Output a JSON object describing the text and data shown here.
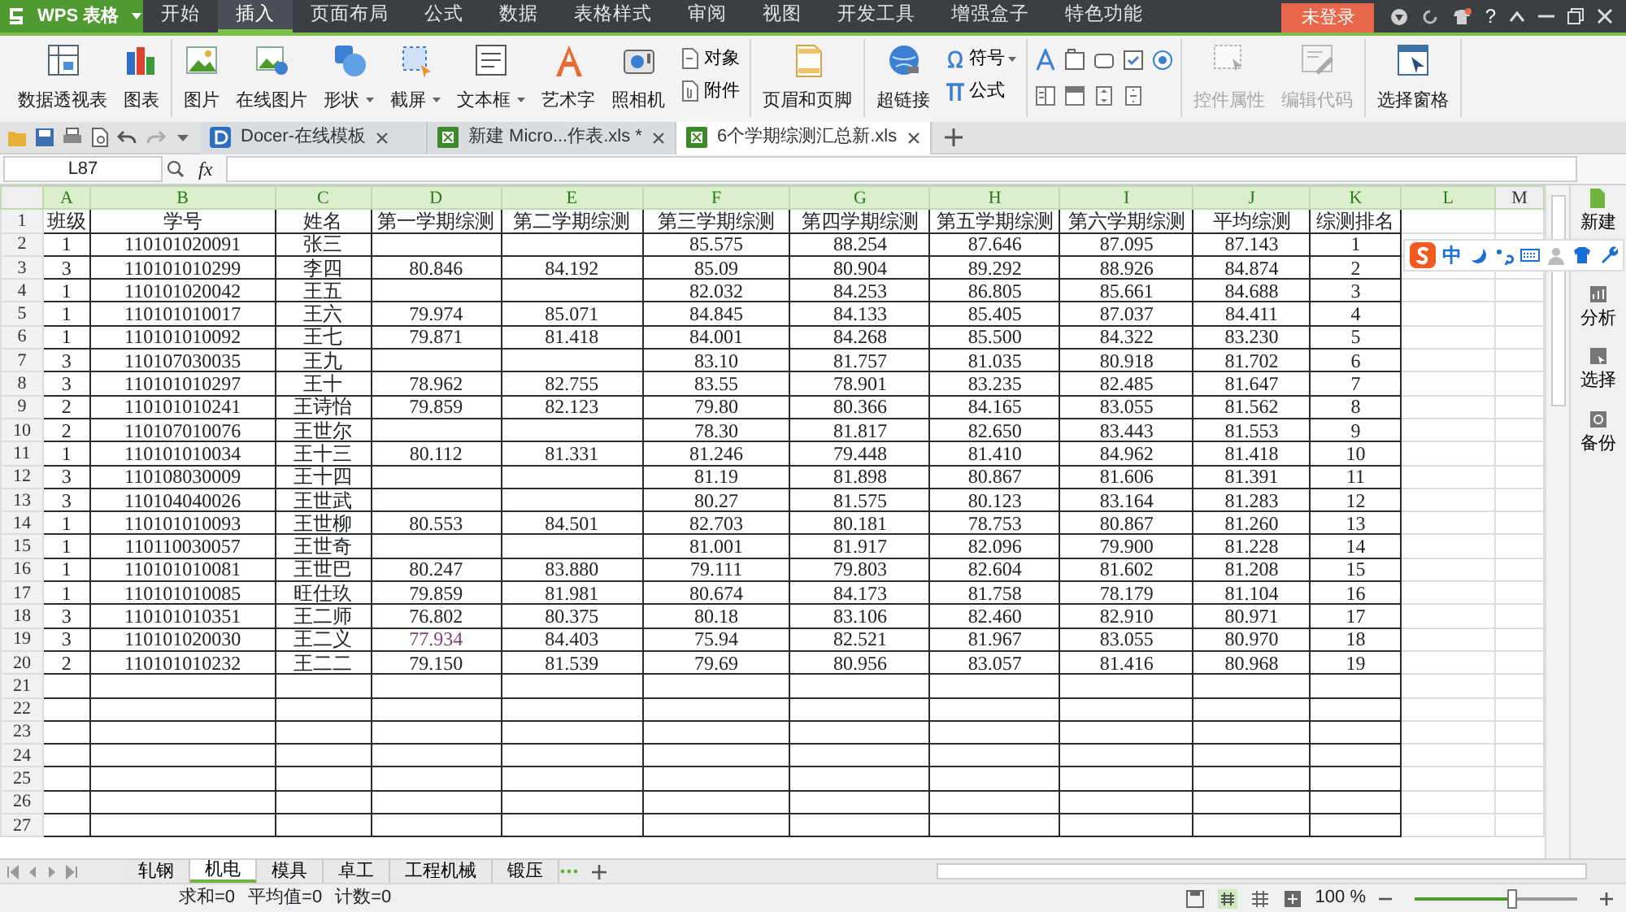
{
  "app": {
    "logo": "WPS 表格",
    "menu_tabs": [
      {
        "label": "开始",
        "selected": false
      },
      {
        "label": "插入",
        "selected": true
      },
      {
        "label": "页面布局",
        "selected": false
      },
      {
        "label": "公式",
        "selected": false
      },
      {
        "label": "数据",
        "selected": false
      },
      {
        "label": "表格样式",
        "selected": false
      },
      {
        "label": "审阅",
        "selected": false
      },
      {
        "label": "视图",
        "selected": false
      },
      {
        "label": "开发工具",
        "selected": false
      },
      {
        "label": "增强盒子",
        "selected": false
      },
      {
        "label": "特色功能",
        "selected": false
      }
    ],
    "login_button": "未登录",
    "help": "?"
  },
  "ribbon": {
    "groups": [
      [
        {
          "kind": "large",
          "label": "数据透视表"
        },
        {
          "kind": "large",
          "label": "图表"
        }
      ],
      [
        {
          "kind": "large",
          "label": "图片"
        },
        {
          "kind": "large",
          "label": "在线图片"
        },
        {
          "kind": "large",
          "label": "形状",
          "dropdown": true
        },
        {
          "kind": "large",
          "label": "截屏",
          "dropdown": true
        },
        {
          "kind": "large",
          "label": "文本框",
          "dropdown": true
        },
        {
          "kind": "large",
          "label": "艺术字"
        },
        {
          "kind": "large",
          "label": "照相机"
        },
        {
          "kind": "stack",
          "items": [
            {
              "label": "对象"
            },
            {
              "label": "附件"
            }
          ]
        }
      ],
      [
        {
          "kind": "large",
          "label": "页眉和页脚"
        }
      ],
      [
        {
          "kind": "large",
          "label": "超链接"
        },
        {
          "kind": "stack",
          "items": [
            {
              "label": "符号",
              "dropdown": true
            },
            {
              "label": "公式"
            }
          ]
        }
      ],
      [
        {
          "kind": "icons"
        }
      ],
      [
        {
          "kind": "large",
          "label": "控件属性",
          "disabled": true
        },
        {
          "kind": "large",
          "label": "编辑代码",
          "disabled": true
        }
      ],
      [
        {
          "kind": "large",
          "label": "选择窗格"
        }
      ]
    ]
  },
  "doc_tabs": [
    {
      "label": "Docer-在线模板",
      "selected": false
    },
    {
      "label": "新建 Micro...作表.xls *",
      "selected": false
    },
    {
      "label": "6个学期综测汇总新.xls",
      "selected": true
    }
  ],
  "formula_bar": {
    "name_box": "L87",
    "function_label": "fx"
  },
  "sheet": {
    "columns": [
      "A",
      "B",
      "C",
      "D",
      "E",
      "F",
      "G",
      "H",
      "I",
      "J",
      "K",
      "L",
      "M"
    ],
    "rows": [
      {
        "number": "1",
        "cells": [
          "班级",
          "学号",
          "姓名",
          "第一学期综测",
          "第二学期综测",
          "第三学期综测",
          "第四学期综测",
          "第五学期综测",
          "第六学期综测",
          "平均综测",
          "综测排名"
        ]
      },
      {
        "number": "2",
        "cells": [
          "1",
          "110101020091",
          "张三",
          null,
          null,
          "85.575",
          "88.254",
          "87.646",
          "87.095",
          "87.143",
          "1"
        ]
      },
      {
        "number": "3",
        "cells": [
          "3",
          "110101010299",
          "李四",
          "80.846",
          "84.192",
          "85.09",
          "80.904",
          "89.292",
          "88.926",
          "84.874",
          "2"
        ]
      },
      {
        "number": "4",
        "cells": [
          "1",
          "110101020042",
          "王五",
          null,
          null,
          "82.032",
          "84.253",
          "86.805",
          "85.661",
          "84.688",
          "3"
        ]
      },
      {
        "number": "5",
        "cells": [
          "1",
          "110101010017",
          "王六",
          "79.974",
          "85.071",
          "84.845",
          "84.133",
          "85.405",
          "87.037",
          "84.411",
          "4"
        ]
      },
      {
        "number": "6",
        "cells": [
          "1",
          "110101010092",
          "王七",
          "79.871",
          "81.418",
          "84.001",
          "84.268",
          "85.500",
          "84.322",
          "83.230",
          "5"
        ]
      },
      {
        "number": "7",
        "cells": [
          "3",
          "110107030035",
          "王九",
          null,
          null,
          "83.10",
          "81.757",
          "81.035",
          "80.918",
          "81.702",
          "6"
        ]
      },
      {
        "number": "8",
        "cells": [
          "3",
          "110101010297",
          "王十",
          "78.962",
          "82.755",
          "83.55",
          "78.901",
          "83.235",
          "82.485",
          "81.647",
          "7"
        ]
      },
      {
        "number": "9",
        "cells": [
          "2",
          "110101010241",
          "王诗怡",
          "79.859",
          "82.123",
          "79.80",
          "80.366",
          "84.165",
          "83.055",
          "81.562",
          "8"
        ]
      },
      {
        "number": "10",
        "cells": [
          "2",
          "110107010076",
          "王世尔",
          null,
          null,
          "78.30",
          "81.817",
          "82.650",
          "83.443",
          "81.553",
          "9"
        ]
      },
      {
        "number": "11",
        "cells": [
          "1",
          "110101010034",
          "王十三",
          "80.112",
          "81.331",
          "81.246",
          "79.448",
          "81.410",
          "84.962",
          "81.418",
          "10"
        ]
      },
      {
        "number": "12",
        "cells": [
          "3",
          "110108030009",
          "王十四",
          null,
          null,
          "81.19",
          "81.898",
          "80.867",
          "81.606",
          "81.391",
          "11"
        ]
      },
      {
        "number": "13",
        "cells": [
          "3",
          "110104040026",
          "王世武",
          null,
          null,
          "80.27",
          "81.575",
          "80.123",
          "83.164",
          "81.283",
          "12"
        ]
      },
      {
        "number": "14",
        "cells": [
          "1",
          "110101010093",
          "王世柳",
          "80.553",
          "84.501",
          "82.703",
          "80.181",
          "78.753",
          "80.867",
          "81.260",
          "13"
        ]
      },
      {
        "number": "15",
        "cells": [
          "1",
          "110110030057",
          "王世奇",
          null,
          null,
          "81.001",
          "81.917",
          "82.096",
          "79.900",
          "81.228",
          "14"
        ]
      },
      {
        "number": "16",
        "cells": [
          "1",
          "110101010081",
          "王世巴",
          "80.247",
          "83.880",
          "79.111",
          "79.803",
          "82.604",
          "81.602",
          "81.208",
          "15"
        ]
      },
      {
        "number": "17",
        "cells": [
          "1",
          "110101010085",
          "旺仕玖",
          "79.859",
          "81.981",
          "80.674",
          "84.173",
          "81.758",
          "78.179",
          "81.104",
          "16"
        ]
      },
      {
        "number": "18",
        "cells": [
          "3",
          "110101010351",
          "王二师",
          "76.802",
          "80.375",
          "80.18",
          "83.106",
          "82.460",
          "82.910",
          "80.971",
          "17"
        ]
      },
      {
        "number": "19",
        "cells": [
          "3",
          "110101020030",
          "王二义",
          {
            "text": "77.934",
            "color": "#7a3d7a"
          },
          "84.403",
          "75.94",
          "82.521",
          "81.967",
          "83.055",
          "80.970",
          "18"
        ]
      },
      {
        "number": "20",
        "cells": [
          "2",
          "110101010232",
          "王二二",
          "79.150",
          "81.539",
          "79.69",
          "80.956",
          "83.057",
          "81.416",
          "80.968",
          "19"
        ]
      },
      {
        "number": "21"
      },
      {
        "number": "22"
      },
      {
        "number": "23"
      },
      {
        "number": "24"
      },
      {
        "number": "25"
      },
      {
        "number": "26"
      },
      {
        "number": "27"
      }
    ]
  },
  "ime_toolbar": {
    "mode": "中"
  },
  "sidebar": [
    "新建",
    "分析",
    "选择",
    "备份"
  ],
  "sheet_tabs": [
    {
      "label": "轧钢",
      "selected": false
    },
    {
      "label": "机电",
      "selected": true
    },
    {
      "label": "模具",
      "selected": false
    },
    {
      "label": "卓工",
      "selected": false
    },
    {
      "label": "工程机械",
      "selected": false
    },
    {
      "label": "锻压",
      "selected": false
    }
  ],
  "status_bar": {
    "stats": [
      "求和=0",
      "平均值=0",
      "计数=0"
    ],
    "zoom": "100 %",
    "zoom_slider": {
      "level": 0.6
    }
  }
}
